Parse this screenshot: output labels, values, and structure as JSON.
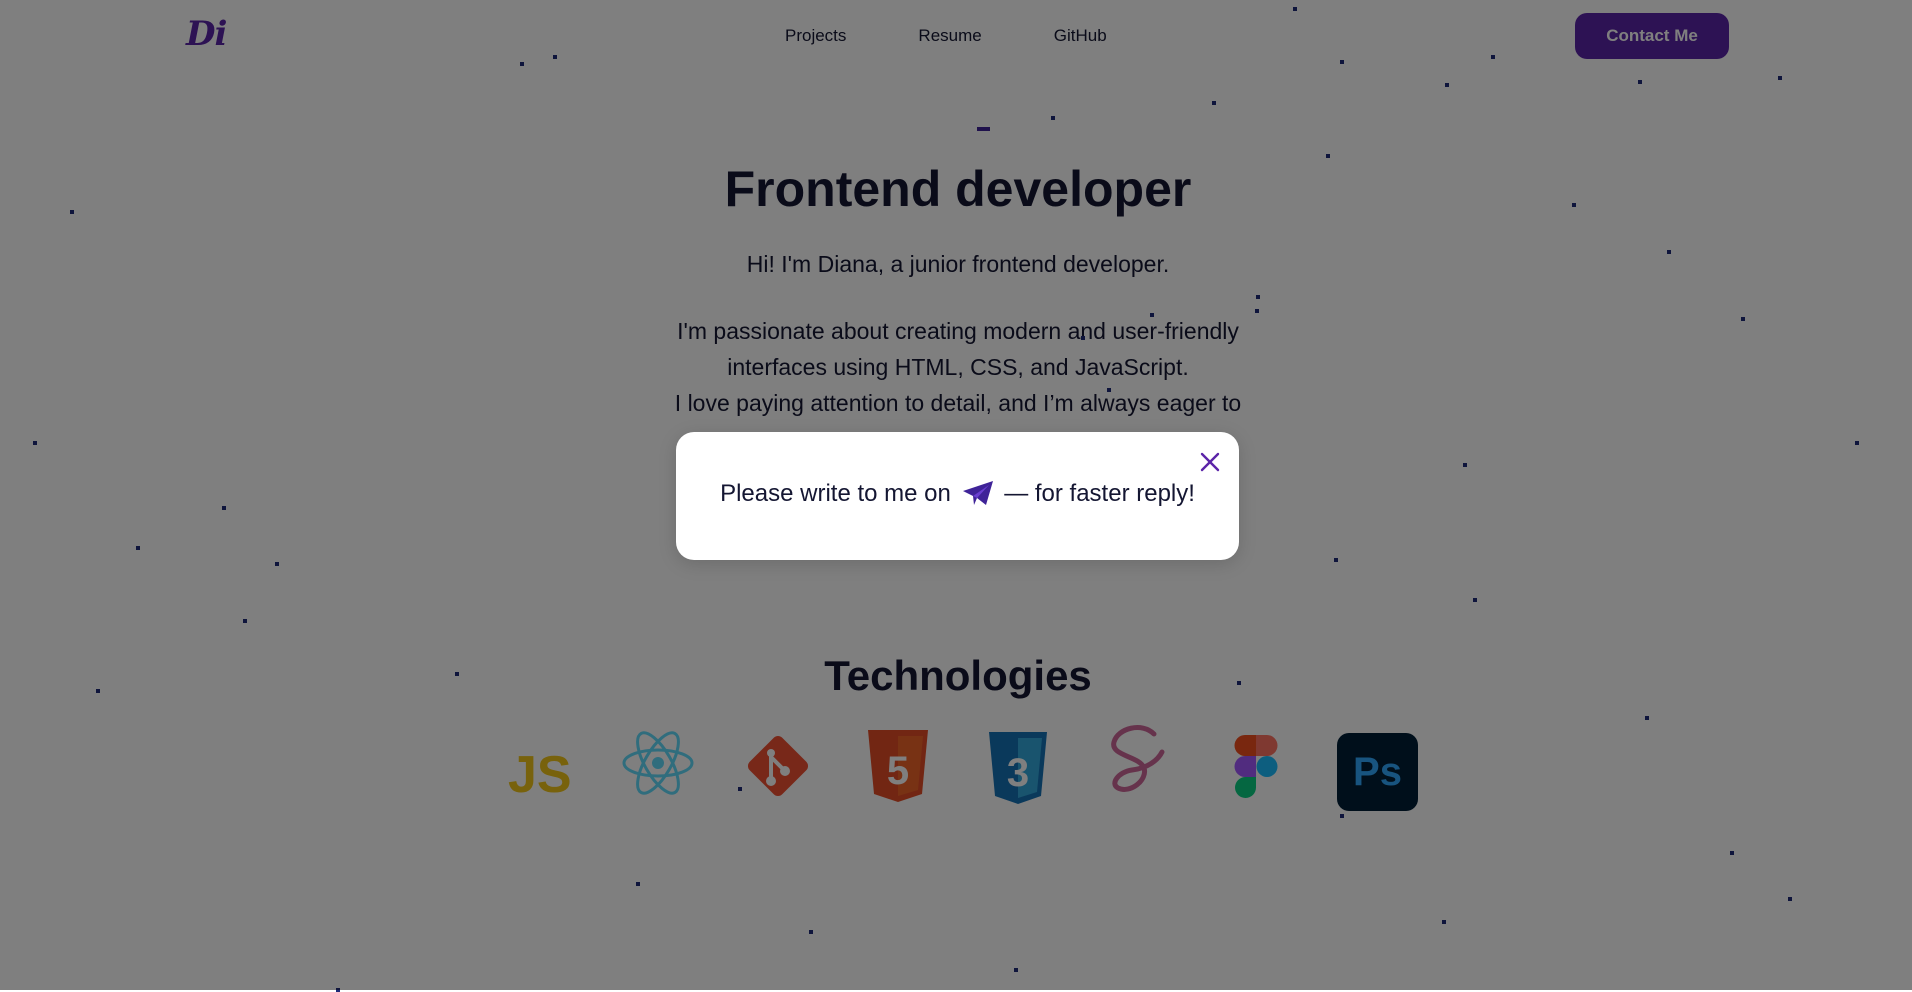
{
  "header": {
    "logo_text": "Di",
    "nav": [
      {
        "label": "Projects"
      },
      {
        "label": "Resume"
      },
      {
        "label": "GitHub"
      }
    ],
    "contact_button": "Contact Me"
  },
  "hero": {
    "title": "Frontend developer",
    "intro": "Hi! I'm Diana, a junior frontend developer.",
    "description_lines": [
      "I'm passionate about creating modern and user-friendly",
      "interfaces using HTML, CSS, and JavaScript.",
      "I love paying attention to detail, and I’m always eager to"
    ]
  },
  "technologies": {
    "title": "Technologies",
    "icons": [
      {
        "name": "javascript-icon",
        "text": "JS",
        "color": "#f0c419"
      },
      {
        "name": "react-icon",
        "color": "#61dafb"
      },
      {
        "name": "git-icon",
        "color": "#f05133"
      },
      {
        "name": "html5-icon",
        "text": "5",
        "color": "#e44d26"
      },
      {
        "name": "css3-icon",
        "text": "3",
        "color": "#1572b6"
      },
      {
        "name": "sass-icon",
        "color": "#cd6799"
      },
      {
        "name": "figma-icon",
        "color": "#f24e1e"
      },
      {
        "name": "photoshop-icon",
        "text": "Ps",
        "color": "#31a8ff"
      }
    ]
  },
  "modal": {
    "message_before": "Please write to me on",
    "message_after": "— for faster reply!",
    "link_icon": "telegram-icon"
  },
  "colors": {
    "accent": "#5b24a8",
    "text": "#141632",
    "overlay": "rgba(0,0,0,0.5)",
    "dots": "#1e2a78"
  }
}
